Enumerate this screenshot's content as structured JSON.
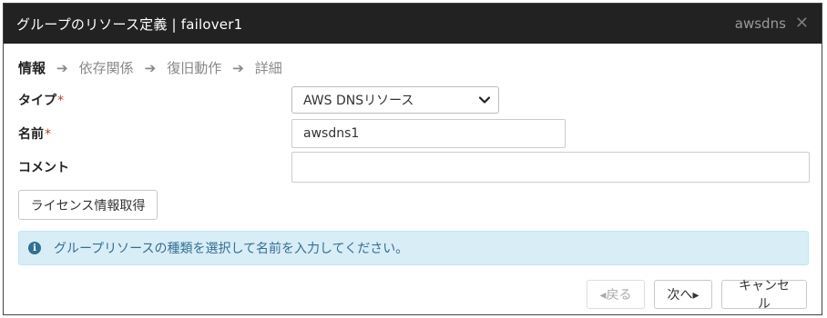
{
  "dialog": {
    "title": "グループのリソース定義 | failover1",
    "resource_name": "awsdns",
    "close_icon": "close-icon"
  },
  "steps": [
    {
      "label": "情報",
      "active": true
    },
    {
      "label": "依存関係",
      "active": false
    },
    {
      "label": "復旧動作",
      "active": false
    },
    {
      "label": "詳細",
      "active": false
    }
  ],
  "form": {
    "type_label": "タイプ",
    "type_value": "AWS DNSリソース",
    "name_label": "名前",
    "name_value": "awsdns1",
    "comment_label": "コメント",
    "comment_value": "",
    "required_mark": "*"
  },
  "license_button": "ライセンス情報取得",
  "info": {
    "icon": "info-icon",
    "message": "グループリソースの種類を選択して名前を入力してください。"
  },
  "footer": {
    "back_label": "◂戻る",
    "next_label": "次へ▸",
    "cancel_label": "キャンセル"
  },
  "colors": {
    "titlebar_bg": "#222222",
    "info_bg": "#d9edf7",
    "info_text": "#31708f",
    "required": "#c0392b"
  }
}
